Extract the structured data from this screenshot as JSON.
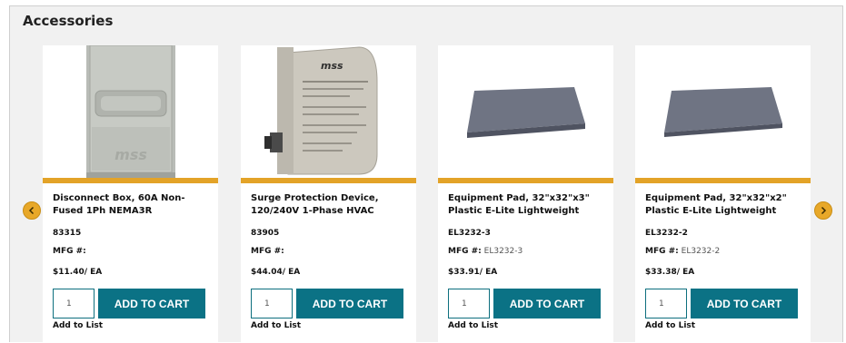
{
  "section": {
    "title": "Accessories"
  },
  "carousel": {
    "prev_icon": "chevron-left-icon",
    "next_icon": "chevron-right-icon",
    "accent_color": "#e3a328",
    "button_color": "#0b7285"
  },
  "products": [
    {
      "name": "Disconnect Box, 60A Non-Fused 1Ph NEMA3R",
      "sku": "83315",
      "mfg_label": "MFG #:",
      "mfg_value": "",
      "price": "$11.40/ EA",
      "qty": "1",
      "add_to_cart": "ADD TO CART",
      "add_to_list": "Add to List",
      "image_text": "mss"
    },
    {
      "name": "Surge Protection Device, 120/240V 1-Phase HVAC",
      "sku": "83905",
      "mfg_label": "MFG #:",
      "mfg_value": "",
      "price": "$44.04/ EA",
      "qty": "1",
      "add_to_cart": "ADD TO CART",
      "add_to_list": "Add to List",
      "image_text": "mss"
    },
    {
      "name": "Equipment Pad, 32\"x32\"x3\" Plastic E-Lite Lightweight",
      "sku": "EL3232-3",
      "mfg_label": "MFG #:",
      "mfg_value": "EL3232-3",
      "price": "$33.91/ EA",
      "qty": "1",
      "add_to_cart": "ADD TO CART",
      "add_to_list": "Add to List"
    },
    {
      "name": "Equipment Pad, 32\"x32\"x2\" Plastic E-Lite Lightweight",
      "sku": "EL3232-2",
      "mfg_label": "MFG #:",
      "mfg_value": "EL3232-2",
      "price": "$33.38/ EA",
      "qty": "1",
      "add_to_cart": "ADD TO CART",
      "add_to_list": "Add to List"
    }
  ]
}
